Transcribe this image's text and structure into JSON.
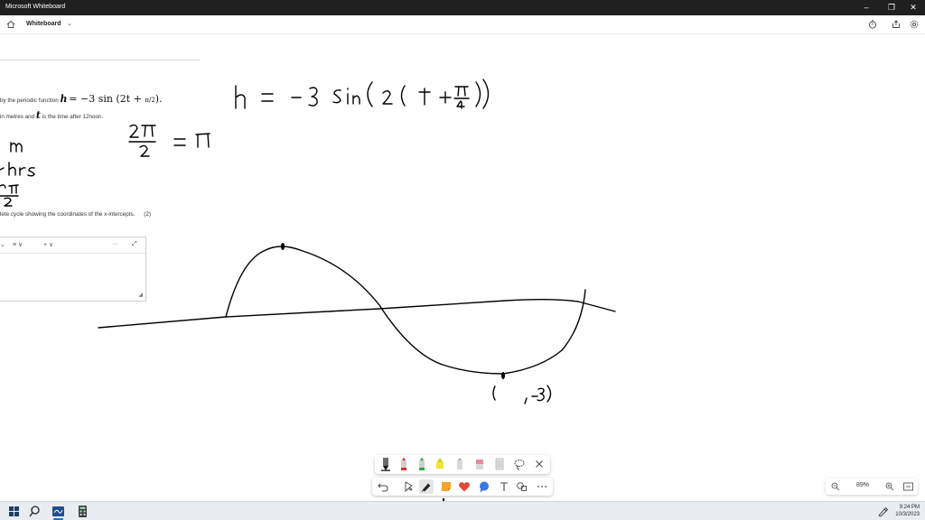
{
  "window": {
    "title": "Microsoft Whiteboard"
  },
  "appbar": {
    "board_title": "Whiteboard"
  },
  "document": {
    "line1_pre": "by the periodic function",
    "line1_math_h": "h",
    "line1_math_eq": "= −3 sin (2t + ",
    "line1_math_frac": "π/2",
    "line1_math_close": ").",
    "line2_pre": "in metres and",
    "line2_math_t": "t",
    "line2_post": "is the time after 12noon.",
    "line3": "lete cycle showing the coordinates of the x-intercepts.",
    "marks": "(2)"
  },
  "editor": {
    "more_label": "···",
    "plus_label": "+ ∨",
    "list_label": "≡ ∨"
  },
  "zoom": {
    "level": "89%",
    "minus": "−",
    "plus": "+"
  },
  "clock": {
    "time": "9:24 PM",
    "date": "10/3/2023"
  },
  "colors": {
    "ink": "#000000",
    "titlebar_bg": "#1f1f1f",
    "taskbar_bg": "#e9edf2",
    "pen_red": "#e03030",
    "pen_green": "#2aa84a",
    "highlighter_yellow": "#f2e531",
    "heart_red": "#e4473b",
    "sticky_orange": "#f4a62a",
    "bubble_blue": "#3b78e7"
  }
}
